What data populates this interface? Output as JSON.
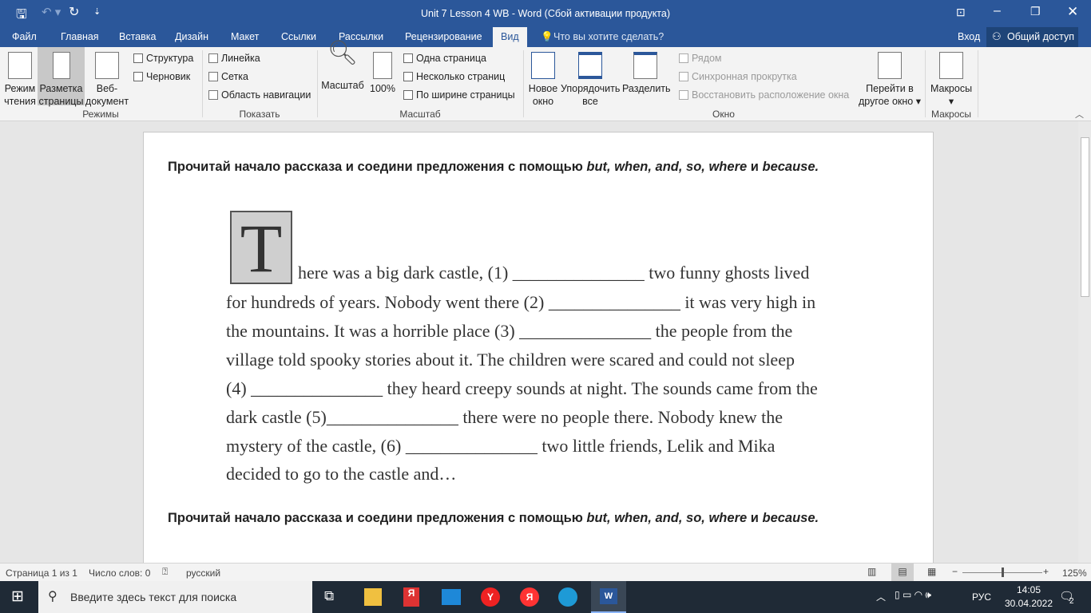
{
  "window": {
    "title": "Unit 7 Lesson 4 WB - Word (Сбой активации продукта)"
  },
  "tabs": [
    "Файл",
    "Главная",
    "Вставка",
    "Дизайн",
    "Макет",
    "Ссылки",
    "Рассылки",
    "Рецензирование",
    "Вид"
  ],
  "tell_me": "Что вы хотите сделать?",
  "signin": "Вход",
  "share": "Общий доступ",
  "ribbon": {
    "modes": {
      "read": "Режим чтения",
      "layout": "Разметка страницы",
      "web": "Веб-документ",
      "outline": "Структура",
      "draft": "Черновик",
      "label": "Режимы"
    },
    "show": {
      "ruler": "Линейка",
      "grid": "Сетка",
      "nav": "Область навигации",
      "label": "Показать"
    },
    "zoom": {
      "zoom": "Масштаб",
      "hundred": "100%",
      "one": "Одна страница",
      "multi": "Несколько страниц",
      "width": "По ширине страницы",
      "label": "Масштаб"
    },
    "window": {
      "new": "Новое окно",
      "arrange": "Упорядочить все",
      "split": "Разделить",
      "side": "Рядом",
      "sync": "Синхронная прокрутка",
      "reset": "Восстановить расположение окна",
      "switch": "Перейти в другое окно",
      "label": "Окно"
    },
    "macros": {
      "macros": "Макросы",
      "label": "Макросы"
    }
  },
  "doc": {
    "heading_pre": "Прочитай начало рассказа и соедини предложения с помощью ",
    "heading_words": "but, when, and, so, where",
    "heading_and": " и ",
    "heading_last": "because.",
    "drop_cap": "T",
    "lines": [
      "here was a big dark castle, (1) _______________ two funny ghosts lived",
      "for hundreds of years. Nobody went there (2) _______________ it was very high in",
      "the mountains. It was a horrible place (3) _______________ the people from the",
      "village told spooky stories about it. The children were scared and could not sleep",
      "(4) _______________ they heard creepy sounds at night. The sounds came from the",
      "dark castle (5)_______________ there were no people there. Nobody knew the",
      "mystery of the castle, (6) _______________ two little friends, Lelik and Mika",
      "decided to go to the castle and…"
    ]
  },
  "status": {
    "page": "Страница 1 из 1",
    "words": "Число слов: 0",
    "lang": "русский",
    "zoom": "125%"
  },
  "taskbar": {
    "search": "Введите здесь текст для поиска",
    "lang": "РУС",
    "time": "14:05",
    "date": "30.04.2022",
    "notif": "2"
  }
}
